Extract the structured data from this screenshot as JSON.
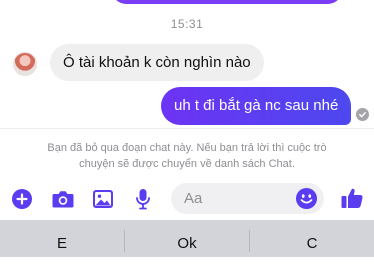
{
  "chat": {
    "timestamp": "15:31",
    "received_message": "Ô tài khoản k còn nghìn nào",
    "sent_message": "uh t đi bắt gà nc sau nhé"
  },
  "notice": {
    "line1": "Bạn đã bỏ qua đoạn chat này. Nếu bạn trả lời thì cuộc trò",
    "line2": "chuyện sẽ được chuyển về danh sách Chat."
  },
  "composer": {
    "placeholder": "Aa",
    "icons": [
      "plus-icon",
      "camera-icon",
      "image-icon",
      "microphone-icon",
      "emoji-icon",
      "thumbs-up-icon"
    ]
  },
  "keyboard": {
    "suggestions": [
      "E",
      "Ok",
      "C"
    ]
  },
  "colors": {
    "accent": "#5b3cf0",
    "sent_bubble_start": "#6d33f4",
    "sent_bubble_end": "#4d48ef",
    "received_bubble": "#efefef",
    "muted_text": "#8e8e93"
  }
}
